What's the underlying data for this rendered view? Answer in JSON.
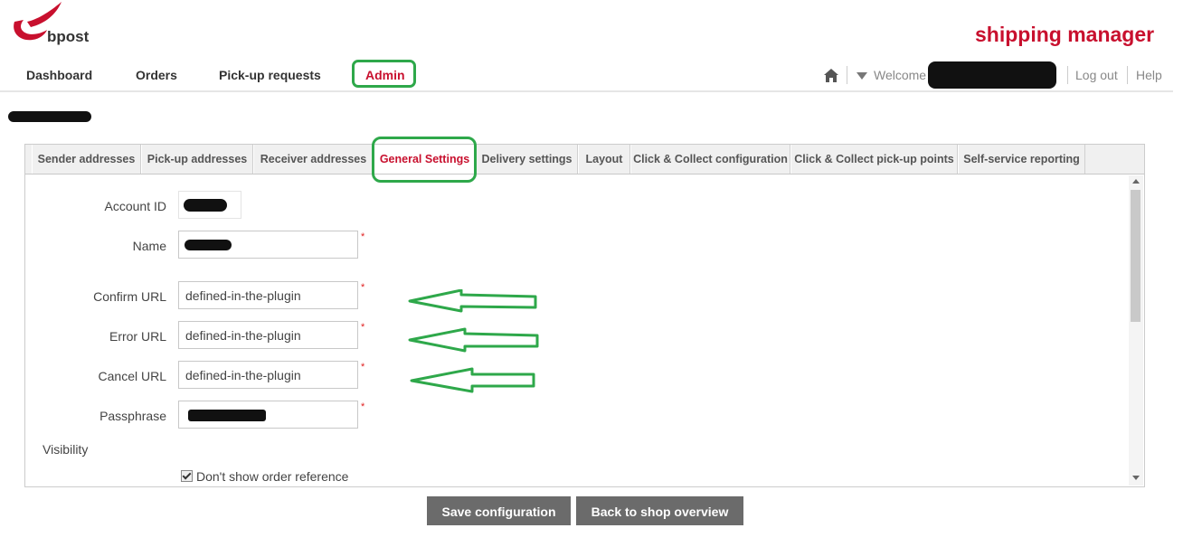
{
  "brand": {
    "logo_text": "bpost",
    "app_title": "shipping manager",
    "brand_color": "#c8102e"
  },
  "nav": {
    "items": [
      {
        "label": "Dashboard"
      },
      {
        "label": "Orders"
      },
      {
        "label": "Pick-up requests"
      },
      {
        "label": "Admin",
        "active": true
      }
    ]
  },
  "topbar": {
    "home_icon": "home-icon",
    "welcome": "Welcome",
    "logout": "Log out",
    "help": "Help"
  },
  "tabs": [
    {
      "label": "Sender addresses"
    },
    {
      "label": "Pick-up addresses"
    },
    {
      "label": "Receiver addresses"
    },
    {
      "label": "General Settings",
      "active": true
    },
    {
      "label": "Delivery settings"
    },
    {
      "label": "Layout"
    },
    {
      "label": "Click & Collect configuration"
    },
    {
      "label": "Click & Collect pick-up points"
    },
    {
      "label": "Self-service reporting"
    }
  ],
  "form": {
    "account_id": {
      "label": "Account ID"
    },
    "name": {
      "label": "Name",
      "required": "*"
    },
    "confirm_url": {
      "label": "Confirm URL",
      "value": "defined-in-the-plugin",
      "required": "*"
    },
    "error_url": {
      "label": "Error URL",
      "value": "defined-in-the-plugin",
      "required": "*"
    },
    "cancel_url": {
      "label": "Cancel URL",
      "value": "defined-in-the-plugin",
      "required": "*"
    },
    "passphrase": {
      "label": "Passphrase",
      "required": "*"
    },
    "visibility": {
      "label": "Visibility"
    },
    "dont_show_order_reference": {
      "label": "Don't show order reference",
      "checked": true
    }
  },
  "actions": {
    "save": "Save configuration",
    "back": "Back to shop overview"
  },
  "colors": {
    "annotation_green": "#2ea84a",
    "button_gray": "#6b6b6b"
  }
}
